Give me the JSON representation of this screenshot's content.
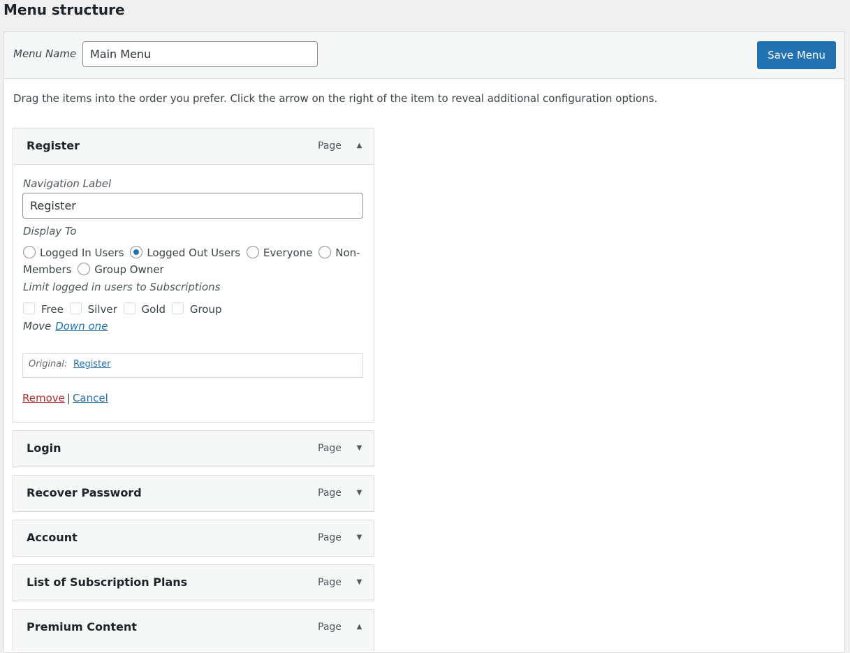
{
  "page": {
    "title": "Menu structure"
  },
  "header": {
    "menu_name_label": "Menu Name",
    "menu_name_value": "Main Menu",
    "save_label": "Save Menu"
  },
  "instructions": "Drag the items into the order you prefer. Click the arrow on the right of the item to reveal additional configuration options.",
  "menu_items": [
    {
      "title": "Register",
      "type": "Page",
      "expanded": true
    },
    {
      "title": "Login",
      "type": "Page",
      "expanded": false
    },
    {
      "title": "Recover Password",
      "type": "Page",
      "expanded": false
    },
    {
      "title": "Account",
      "type": "Page",
      "expanded": false
    },
    {
      "title": "List of Subscription Plans",
      "type": "Page",
      "expanded": false
    },
    {
      "title": "Premium Content",
      "type": "Page",
      "expanded": true
    }
  ],
  "settings": {
    "nav_label_label": "Navigation Label",
    "nav_label_value": "Register",
    "display_to_label": "Display To",
    "display_options": [
      {
        "label": "Logged In Users",
        "selected": false
      },
      {
        "label": "Logged Out Users",
        "selected": true
      },
      {
        "label": "Everyone",
        "selected": false
      },
      {
        "label": "Non-",
        "selected": false
      },
      {
        "label": "Members",
        "selected": false
      },
      {
        "label": "Group Owner",
        "selected": false
      }
    ],
    "limit_label": "Limit logged in users to Subscriptions",
    "subscriptions": [
      {
        "label": "Free",
        "checked": false
      },
      {
        "label": "Silver",
        "checked": false
      },
      {
        "label": "Gold",
        "checked": false
      },
      {
        "label": "Group",
        "checked": false
      }
    ],
    "move_label": "Move",
    "move_link": "Down one",
    "original_label": "Original:",
    "original_link": "Register",
    "remove_label": "Remove",
    "separator": "|",
    "cancel_label": "Cancel"
  },
  "icons": {
    "expanded": "triangle-up-icon",
    "collapsed": "triangle-down-icon"
  },
  "colors": {
    "accent": "#2271b1",
    "danger": "#b32d2e",
    "panel_bg": "#f6f7f7"
  }
}
